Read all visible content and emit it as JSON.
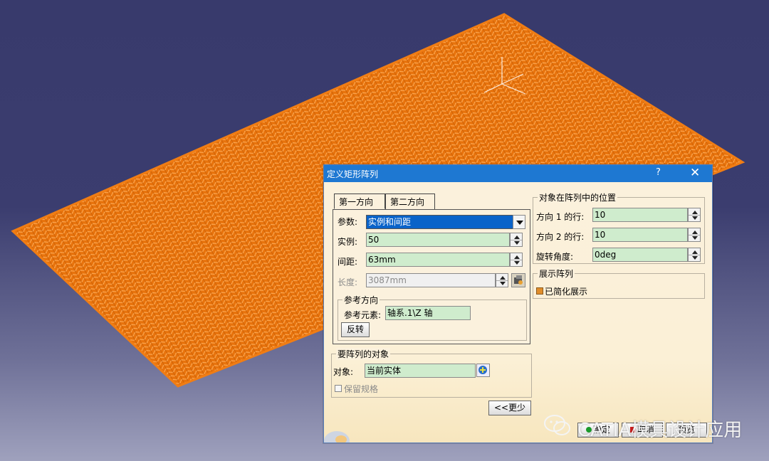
{
  "dialog": {
    "title": "定义矩形阵列",
    "help": "?",
    "close": "✕",
    "tabs": [
      {
        "label": "第一方向",
        "active": true
      },
      {
        "label": "第二方向",
        "active": false
      }
    ],
    "params": {
      "label": "参数:",
      "value": "实例和间距"
    },
    "instances": {
      "label": "实例:",
      "value": "50"
    },
    "spacing": {
      "label": "间距:",
      "value": "63mm"
    },
    "length": {
      "label": "长度:",
      "value": "3087mm"
    },
    "ref_direction": {
      "title": "参考方向",
      "element_label": "参考元素:",
      "element_value": "轴系.1\\Z 轴",
      "reverse_button": "反转"
    },
    "object_group": {
      "title": "要阵列的对象",
      "object_label": "对象:",
      "object_value": "当前实体",
      "keep_spec": "保留规格"
    },
    "less_button": "<<更少",
    "position_group": {
      "title": "对象在阵列中的位置",
      "row1_label": "方向 1 的行:",
      "row1_value": "10",
      "row2_label": "方向 2 的行:",
      "row2_value": "10",
      "rotation_label": "旋转角度:",
      "rotation_value": "0deg"
    },
    "display_group": {
      "title": "展示阵列",
      "simplified": "已简化展示"
    },
    "ok_button": "确定",
    "preview_button": "预览",
    "cancel_button": "取消"
  },
  "watermark": "CATIA模具设计应用",
  "colors": {
    "pattern": "#f07d14",
    "background_top": "#383a6c",
    "field_bg": "#cfeccd",
    "titlebar": "#1e78d2"
  }
}
